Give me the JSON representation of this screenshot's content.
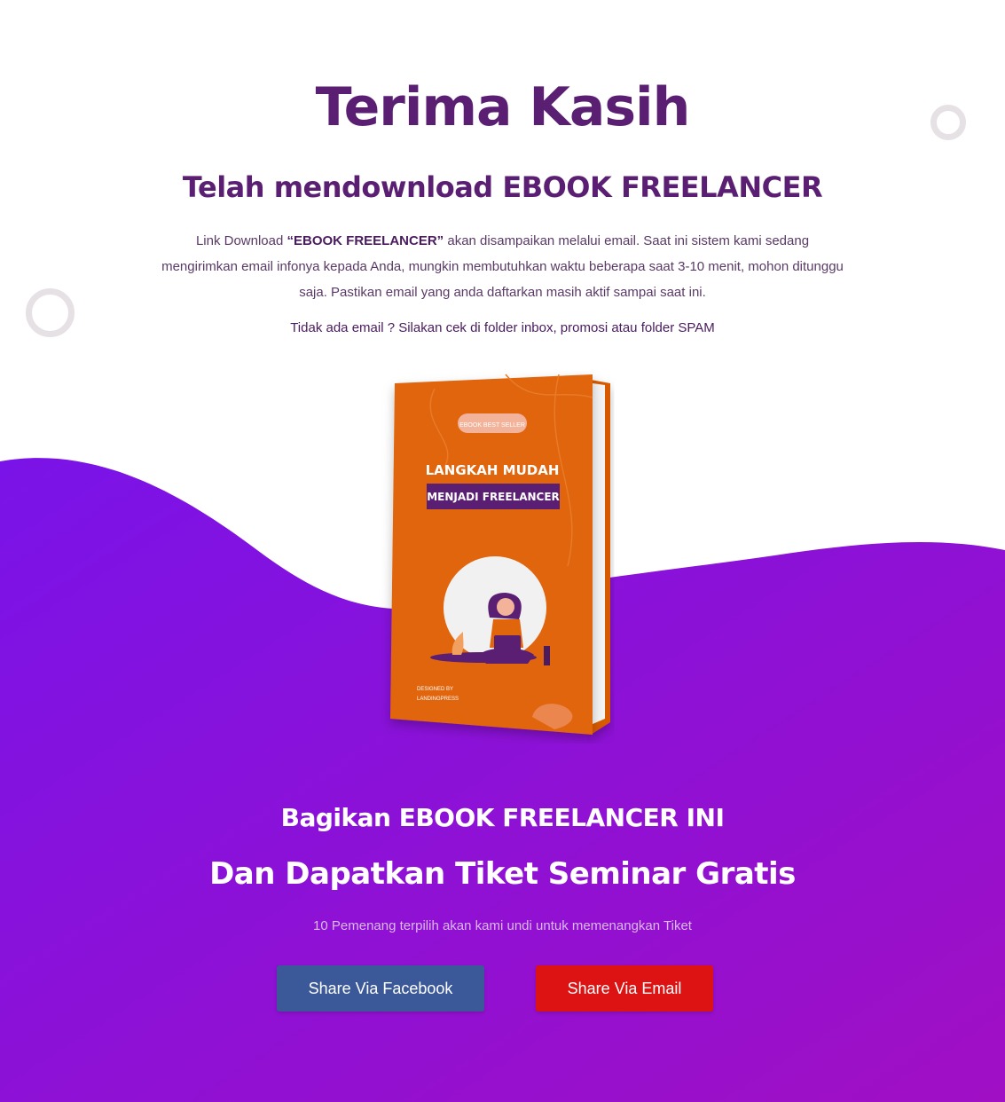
{
  "header": {
    "title": "Terima Kasih",
    "subtitle": "Telah mendownload EBOOK FREELANCER"
  },
  "message": {
    "prefix": "Link Download ",
    "ebook_name": "“EBOOK FREELANCER”",
    "body": " akan disampaikan melalui email. Saat ini sistem kami sedang mengirimkan email infonya kepada Anda, mungkin membutuhkan waktu beberapa saat 3-10 menit, mohon ditunggu saja. Pastikan email yang anda daftarkan masih aktif sampai saat ini.",
    "note": "Tidak ada email ? Silakan cek di folder inbox, promosi atau folder SPAM"
  },
  "book": {
    "badge": "EBOOK BEST SELLER",
    "title_line1": "LANGKAH MUDAH",
    "title_line2": "MENJADI FREELANCER",
    "credit_line1": "DESIGNED BY",
    "credit_line2": "LANDINGPRESS"
  },
  "share": {
    "title": "Bagikan EBOOK FREELANCER INI",
    "subtitle": "Dan Dapatkan Tiket Seminar Gratis",
    "note": "10 Pemenang terpilih akan kami undi untuk memenangkan Tiket",
    "facebook_label": "Share Via Facebook",
    "email_label": "Share Via Email"
  },
  "colors": {
    "heading": "#5a1f72",
    "wave_start": "#7a13e8",
    "wave_end": "#a00fc4",
    "book_cover": "#e0650b",
    "facebook": "#3b5998",
    "email": "#dd1212"
  }
}
